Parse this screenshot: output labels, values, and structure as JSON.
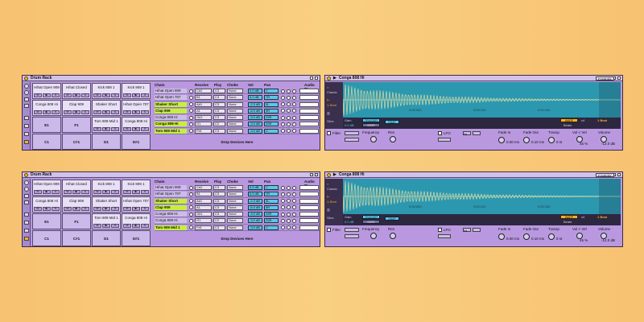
{
  "rows": [
    {
      "rack": {
        "title": "Drum Rack",
        "pads": [
          {
            "name": "Hihat Open 909"
          },
          {
            "name": "Hihat Closed"
          },
          {
            "name": "Kick 808 1"
          },
          {
            "name": "Kick 909 1"
          },
          {
            "name": "Conga 808 Hi"
          },
          {
            "name": "Clap 909"
          },
          {
            "name": "Shaker Short"
          },
          {
            "name": "Hihat Open 707"
          },
          {
            "name": "E1"
          },
          {
            "name": "F1"
          },
          {
            "name": "Tom 909 Mid 1"
          },
          {
            "name": "Conga 808 Hi"
          },
          {
            "name": "C1"
          },
          {
            "name": "C#1"
          },
          {
            "name": "D1"
          },
          {
            "name": "D#1"
          }
        ],
        "pad_controls": [
          "M",
          "▶",
          "S"
        ],
        "headers": {
          "chain": "Chain",
          "receive": "Receive",
          "play": "Play",
          "choke": "Choke",
          "vol": "Vol",
          "pan": "Pan",
          "audio_to": "Audio To"
        },
        "chains": [
          {
            "name": "Hihat Open 909",
            "receive": "C#2",
            "play": "C3",
            "choke": "None",
            "vol": "0.0 dB",
            "pan": "C",
            "green": false
          },
          {
            "name": "Hihat Open 707",
            "receive": "B1",
            "play": "C3",
            "choke": "None",
            "vol": "0.0 dB",
            "pan": "7R",
            "green": false
          },
          {
            "name": "Shaker Short",
            "receive": "A#1",
            "play": "C3",
            "choke": "None",
            "vol": "-2.3 dB",
            "pan": "0L",
            "green": true
          },
          {
            "name": "Clap 909",
            "receive": "A1",
            "play": "C3",
            "choke": "None",
            "vol": "-6.0 dB",
            "pan": "5R",
            "green": true
          },
          {
            "name": "Conga 808 Hi",
            "receive": "G#1",
            "play": "C3",
            "choke": "None",
            "vol": "-3.0 dB",
            "pan": "29R",
            "green": false
          },
          {
            "name": "Conga 808 Hi",
            "receive": "G1",
            "play": "C2",
            "choke": "None",
            "vol": "-3.0 dB",
            "pan": "20R",
            "green": true
          },
          {
            "name": "Tom 909 Mid 1",
            "receive": "F#1",
            "play": "C3",
            "choke": "None",
            "vol": "-3.0 dB",
            "pan": "C",
            "green": true
          }
        ],
        "drop_label": "Drop Devices Here"
      },
      "sampler": {
        "title": "Conga 808 Hi",
        "tabs": [
          "Sample",
          "Controls"
        ],
        "side": {
          "classic": "Classic",
          "one_shot": "1-Shot",
          "slice": "Slice"
        },
        "times": [
          "0:00:050",
          "0:00:100",
          "0:00:150"
        ],
        "gain_label": "Gain",
        "gain_value": "0.0 dB",
        "trigger": "TRIGGER",
        "gate": "GATE",
        "snap": "SNAP",
        "warp": "WARP",
        "warp_x2": "x4",
        "beats_label": "Beats",
        "beats_value": "1 Beat",
        "bottom": {
          "filter": "Filter",
          "frequency": "Frequency",
          "res": "Res",
          "lfo": "LFO",
          "hz": "Hz",
          "fade_in": "Fade In",
          "fade_in_val": "0.00 ms",
          "fade_out": "Fade Out",
          "fade_out_val": "0.10 ms",
          "transp": "Transp",
          "transp_val": "0 st",
          "vol_vel": "Vol < Vel",
          "vol_vel_val": "45 %",
          "volume": "Volume",
          "volume_val": "-12.0 dB"
        }
      }
    },
    {
      "rack": {
        "title": "Drum Rack",
        "pads": [
          {
            "name": "Hihat Open 909"
          },
          {
            "name": "Hihat Closed"
          },
          {
            "name": "Kick 808 1"
          },
          {
            "name": "Kick 909 1"
          },
          {
            "name": "Conga 808 Hi"
          },
          {
            "name": "Clap 909"
          },
          {
            "name": "Shaker Short"
          },
          {
            "name": "Hihat Open 707"
          },
          {
            "name": "E1"
          },
          {
            "name": "F1"
          },
          {
            "name": "Tom 909 Mid 1"
          },
          {
            "name": "Conga 808 Hi"
          },
          {
            "name": "C1"
          },
          {
            "name": "C#1"
          },
          {
            "name": "D1"
          },
          {
            "name": "D#1"
          }
        ],
        "pad_controls": [
          "M",
          "▶",
          "S"
        ],
        "headers": {
          "chain": "Chain",
          "receive": "Receive",
          "play": "Play",
          "choke": "Choke",
          "vol": "Vol",
          "pan": "Pan",
          "audio_to": "Audio To"
        },
        "chains": [
          {
            "name": "Hihat Open 909",
            "receive": "C#2",
            "play": "C3",
            "choke": "None",
            "vol": "0.0 dB",
            "pan": "C",
            "green": false
          },
          {
            "name": "Hihat Open 707",
            "receive": "B1",
            "play": "C3",
            "choke": "None",
            "vol": "0.0 dB",
            "pan": "7R",
            "green": false
          },
          {
            "name": "Shaker Short",
            "receive": "A#1",
            "play": "C3",
            "choke": "None",
            "vol": "-2.3 dB",
            "pan": "0L",
            "green": true
          },
          {
            "name": "Clap 909",
            "receive": "A1",
            "play": "C3",
            "choke": "None",
            "vol": "-6.0 dB",
            "pan": "5R",
            "green": true
          },
          {
            "name": "Conga 808 Hi",
            "receive": "G#1",
            "play": "C3",
            "choke": "None",
            "vol": "-3.0 dB",
            "pan": "29R",
            "green": false
          },
          {
            "name": "Conga 808 Hi",
            "receive": "G1",
            "play": "C2",
            "choke": "None",
            "vol": "-3.0 dB",
            "pan": "20R",
            "green": false
          },
          {
            "name": "Tom 909 Mid 1",
            "receive": "F#1",
            "play": "C3",
            "choke": "None",
            "vol": "-3.0 dB",
            "pan": "C",
            "green": true
          }
        ],
        "drop_label": "Drop Devices Here"
      },
      "sampler": {
        "title": "Conga 808 Hi",
        "tabs": [
          "Sample",
          "Controls"
        ],
        "side": {
          "classic": "Classic",
          "one_shot": "1-Shot",
          "slice": "Slice"
        },
        "times": [
          "0:00:050",
          "0:00:100",
          "0:00:150"
        ],
        "gain_label": "Gain",
        "gain_value": "0.0 dB",
        "trigger": "TRIGGER",
        "gate": "GATE",
        "snap": "SNAP",
        "warp": "WARP",
        "warp_x2": "x4",
        "beats_label": "Beats",
        "beats_value": "1 Beat",
        "bottom": {
          "filter": "Filter",
          "frequency": "Frequency",
          "res": "Res",
          "lfo": "LFO",
          "hz": "Hz",
          "fade_in": "Fade In",
          "fade_in_val": "0.00 ms",
          "fade_out": "Fade Out",
          "fade_out_val": "0.10 ms",
          "transp": "Transp",
          "transp_val": "0 st",
          "vol_vel": "Vol < Vel",
          "vol_vel_val": "45 %",
          "volume": "Volume",
          "volume_val": "-12.0 dB"
        }
      }
    }
  ]
}
